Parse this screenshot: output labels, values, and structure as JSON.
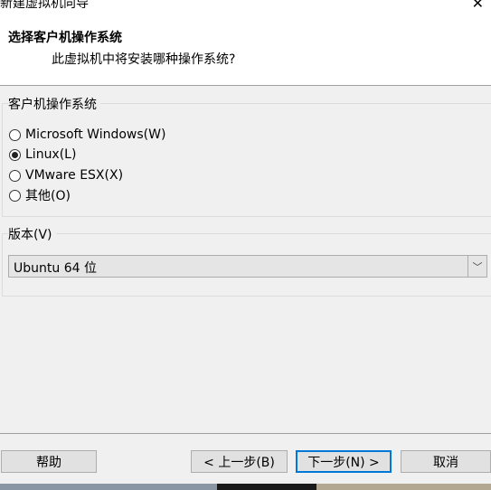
{
  "window": {
    "title": "新建虚拟机向导"
  },
  "header": {
    "title": "选择客户机操作系统",
    "subtitle": "此虚拟机中将安装哪种操作系统?"
  },
  "guest_os": {
    "label": "客户机操作系统",
    "options": [
      {
        "label": "Microsoft Windows(W)",
        "checked": false
      },
      {
        "label": "Linux(L)",
        "checked": true
      },
      {
        "label": "VMware ESX(X)",
        "checked": false
      },
      {
        "label": "其他(O)",
        "checked": false
      }
    ]
  },
  "version": {
    "label": "版本(V)",
    "selected": "Ubuntu 64 位"
  },
  "buttons": {
    "help": "帮助",
    "back": "< 上一步(B)",
    "next": "下一步(N) >",
    "cancel": "取消"
  }
}
